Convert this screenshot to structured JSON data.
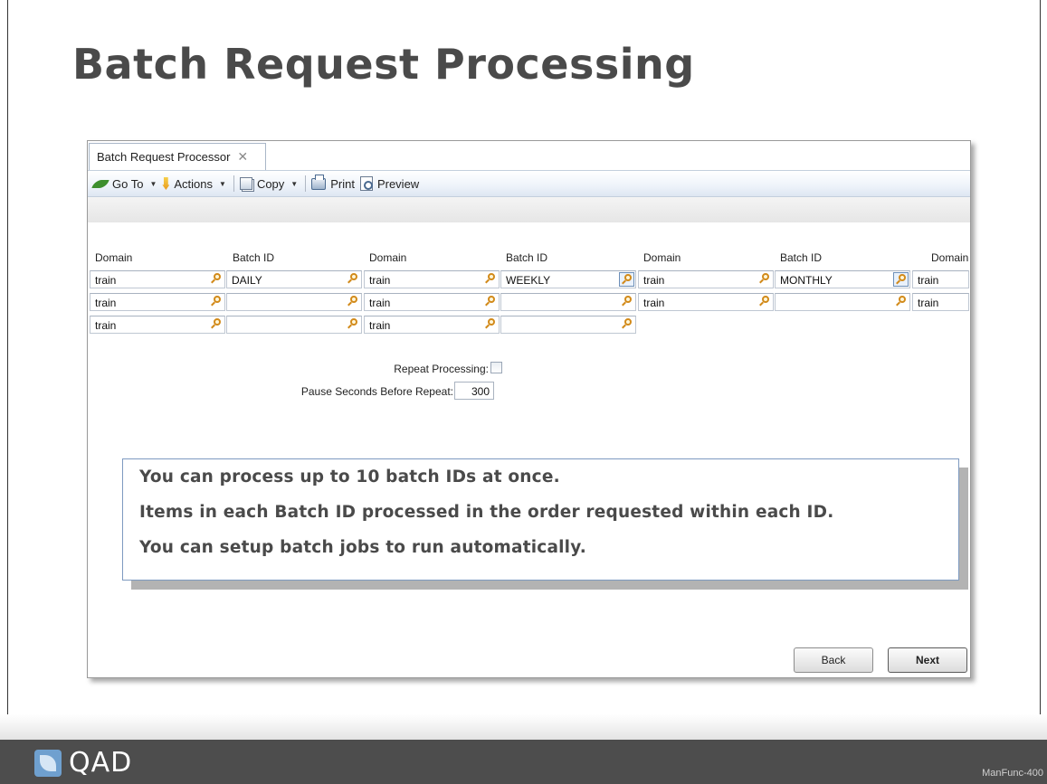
{
  "slide": {
    "title": "Batch Request Processing",
    "footer_code": "ManFunc-400",
    "logo_text": "QAD"
  },
  "app": {
    "tab_label": "Batch Request Processor",
    "toolbar": {
      "goto": "Go To",
      "actions": "Actions",
      "copy": "Copy",
      "print": "Print",
      "preview": "Preview"
    },
    "column_labels": [
      "Domain",
      "Batch ID",
      "Domain",
      "Batch ID",
      "Domain",
      "Batch ID",
      "Domain"
    ],
    "rows": [
      [
        "train",
        "DAILY",
        "train",
        "WEEKLY",
        "train",
        "MONTHLY",
        "train"
      ],
      [
        "train",
        "",
        "train",
        "",
        "train",
        "",
        "train"
      ],
      [
        "train",
        "",
        "train",
        ""
      ]
    ],
    "repeat_processing_label": "Repeat Processing:",
    "repeat_processing_checked": false,
    "pause_label": "Pause Seconds Before Repeat:",
    "pause_value": "300",
    "back_label": "Back",
    "next_label": "Next"
  },
  "callout": {
    "lines": [
      "You can process up to 10 batch IDs at once.",
      "Items in each Batch ID processed in the order requested within each ID.",
      "You can setup batch jobs to run automatically."
    ]
  },
  "colors": {
    "title": "#4a4a4a",
    "bottom_bar": "#4d4d4d",
    "callout_border": "#7e9ac0",
    "lookup_icon": "#d28a1a"
  }
}
